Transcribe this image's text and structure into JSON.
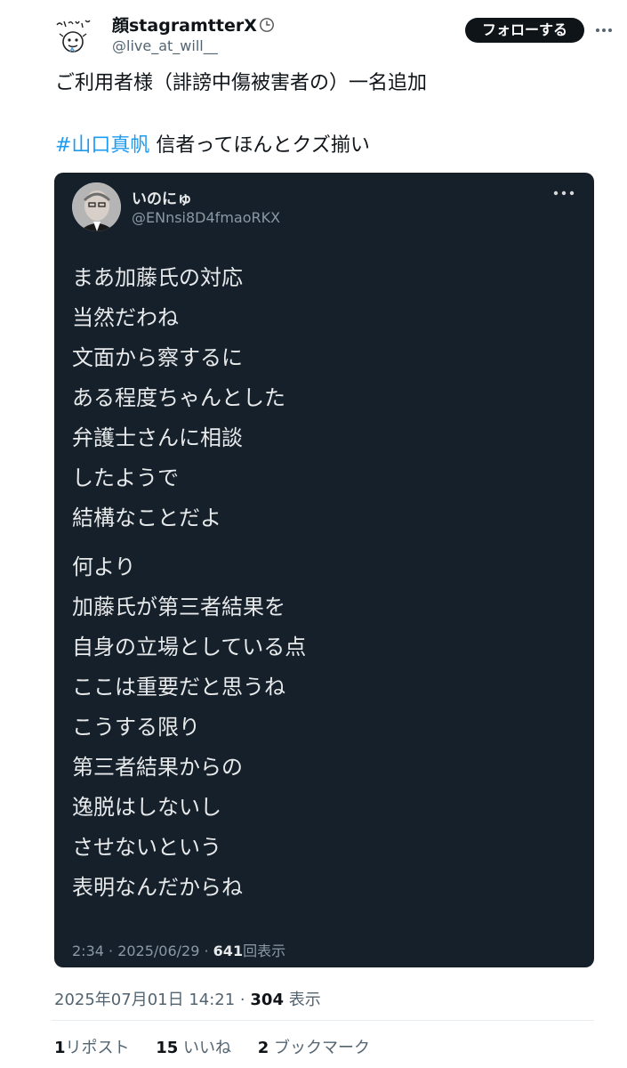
{
  "author": {
    "display_name": "顔stagramtterX",
    "handle": "@live_at_will__",
    "follow_label": "フォローする"
  },
  "tweet": {
    "line1": "ご利用者様（誹謗中傷被害者の）一名追加",
    "hashtag": "#山口真帆",
    "line2_rest": " 信者ってほんとクズ揃い"
  },
  "quote": {
    "display_name": "いのにゅ",
    "handle": "@ENnsi8D4fmaoRKX",
    "paragraph1": [
      "まあ加藤氏の対応",
      "当然だわね",
      "文面から察するに",
      "ある程度ちゃんとした",
      "弁護士さんに相談",
      "したようで",
      "結構なことだよ"
    ],
    "paragraph2": [
      "何より",
      "加藤氏が第三者結果を",
      "自身の立場としている点",
      "ここは重要だと思うね",
      "こうする限り",
      "第三者結果からの",
      "逸脱はしないし",
      "させないという",
      "表明なんだからね"
    ],
    "meta_time": "2:34 · 2025/06/29 · ",
    "meta_views_count": "641",
    "meta_views_label": "回表示"
  },
  "timestamp": {
    "datetime": "2025年07月01日 14:21 · ",
    "views_count": "304",
    "views_label": " 表示"
  },
  "stats": {
    "reposts_count": "1",
    "reposts_label": "リポスト",
    "likes_count": "15",
    "likes_label": " いいね",
    "bookmarks_count": "2",
    "bookmarks_label": " ブックマーク"
  },
  "colors": {
    "accent": "#1d9bf0",
    "card_bg": "#15202b",
    "text": "#0f1419",
    "muted": "#536471"
  },
  "icons": [
    "avatar-doodle",
    "clock-icon",
    "more-icon",
    "quote-more-icon"
  ]
}
